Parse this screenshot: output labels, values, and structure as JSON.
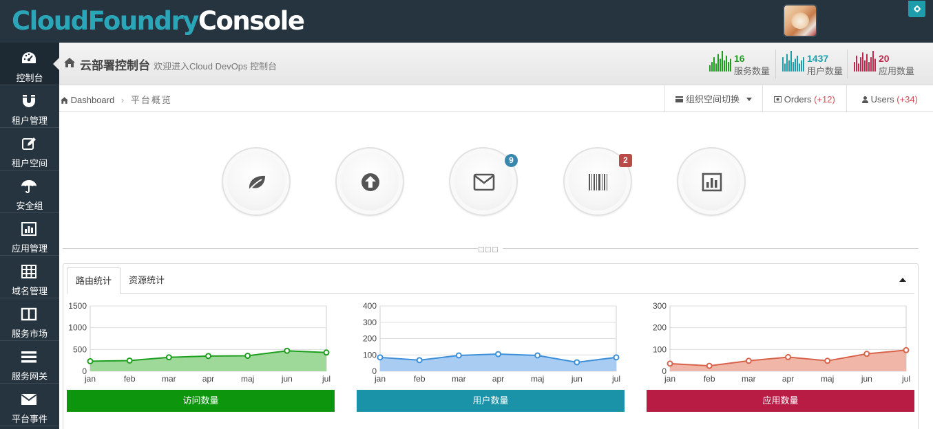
{
  "header": {
    "logo_part1": "CloudFoundry",
    "logo_part2": "Console"
  },
  "sidebar": {
    "items": [
      {
        "label": "控制台",
        "icon": "dashboard-icon"
      },
      {
        "label": "租户管理",
        "icon": "magnet-icon"
      },
      {
        "label": "租户空间",
        "icon": "edit-icon"
      },
      {
        "label": "安全组",
        "icon": "umbrella-icon"
      },
      {
        "label": "应用管理",
        "icon": "bar-chart-icon"
      },
      {
        "label": "域名管理",
        "icon": "table-icon"
      },
      {
        "label": "服务市场",
        "icon": "columns-icon"
      },
      {
        "label": "服务网关",
        "icon": "reorder-icon"
      },
      {
        "label": "平台事件",
        "icon": "envelope-icon"
      }
    ]
  },
  "page_header": {
    "title": "云部署控制台",
    "subtitle": "欢迎进入Cloud DevOps 控制台",
    "stats": [
      {
        "value": "16",
        "label": "服务数量",
        "color": "#1e9e1e",
        "spark": [
          4,
          6,
          9,
          5,
          11,
          8,
          13,
          7,
          10,
          6,
          8
        ]
      },
      {
        "value": "1437",
        "label": "用户数量",
        "color": "#1d9cab",
        "spark": [
          9,
          5,
          11,
          7,
          13,
          6,
          8,
          10,
          5,
          7,
          9,
          12
        ]
      },
      {
        "value": "20",
        "label": "应用数量",
        "color": "#c1284b",
        "spark": [
          6,
          10,
          5,
          9,
          12,
          7,
          11,
          6,
          9,
          13,
          8
        ]
      }
    ]
  },
  "breadcrumb": {
    "home": "Dashboard",
    "current": "平台概览"
  },
  "toolbar": {
    "org_switch": "组织空间切换",
    "orders_label": "Orders",
    "orders_count": "(+12)",
    "users_label": "Users",
    "users_count": "(+34)"
  },
  "shortcuts": [
    {
      "icon": "leaf-icon",
      "badge": ""
    },
    {
      "icon": "circle-arrow-up-icon",
      "badge": ""
    },
    {
      "icon": "envelope-icon",
      "badge": "9"
    },
    {
      "icon": "barcode-icon",
      "badge": "2"
    },
    {
      "icon": "bar-chart-icon",
      "badge": ""
    }
  ],
  "tabs": [
    "路由统计",
    "资源统计"
  ],
  "chart_data": [
    {
      "type": "area",
      "categories": [
        "jan",
        "feb",
        "mar",
        "apr",
        "maj",
        "jun",
        "jul"
      ],
      "series": [
        {
          "values": [
            230,
            245,
            320,
            350,
            355,
            470,
            430
          ]
        }
      ],
      "ylim": [
        0,
        1500
      ],
      "yticks": [
        0,
        500,
        1000,
        1500
      ],
      "color": "#1e9e1e",
      "fill": "#9fd99a",
      "button_label": "访问数量",
      "button_color": "#0d960d"
    },
    {
      "type": "area",
      "categories": [
        "jan",
        "feb",
        "mar",
        "apr",
        "maj",
        "jun",
        "jul"
      ],
      "series": [
        {
          "values": [
            85,
            68,
            97,
            105,
            97,
            55,
            85
          ]
        }
      ],
      "ylim": [
        0,
        400
      ],
      "yticks": [
        0,
        100,
        200,
        300,
        400
      ],
      "color": "#3d8fd9",
      "fill": "#a9cdf2",
      "button_label": "用户数量",
      "button_color": "#1a93a8"
    },
    {
      "type": "area",
      "categories": [
        "jan",
        "feb",
        "mar",
        "apr",
        "maj",
        "jun",
        "jul"
      ],
      "series": [
        {
          "values": [
            35,
            25,
            48,
            65,
            48,
            80,
            97
          ]
        }
      ],
      "ylim": [
        0,
        300
      ],
      "yticks": [
        0,
        100,
        200,
        300
      ],
      "color": "#d9624a",
      "fill": "#f0b6a8",
      "button_label": "应用数量",
      "button_color": "#b81c45"
    }
  ]
}
